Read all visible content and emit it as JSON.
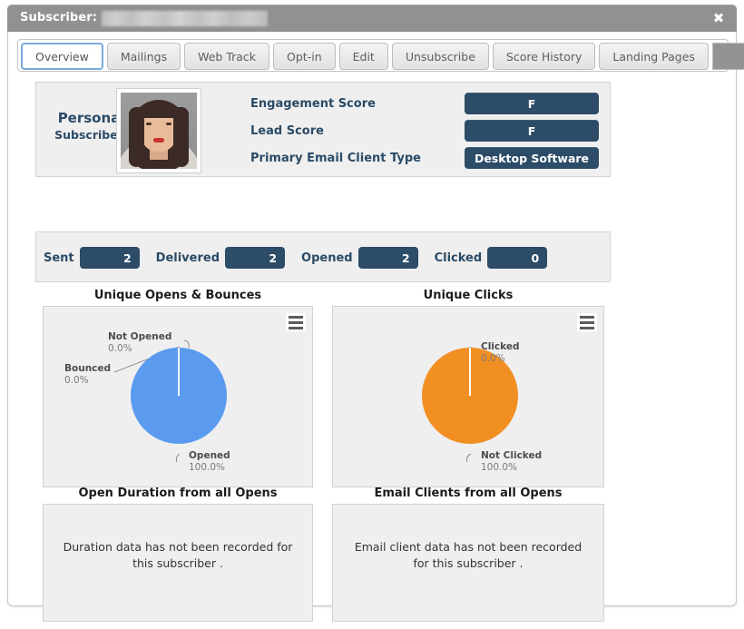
{
  "window": {
    "title_label": "Subscriber:",
    "subscriber_email_redacted": "",
    "close_label": "✖"
  },
  "tabs": [
    {
      "label": "Overview",
      "active": true
    },
    {
      "label": "Mailings",
      "active": false
    },
    {
      "label": "Web Track",
      "active": false
    },
    {
      "label": "Opt-in",
      "active": false
    },
    {
      "label": "Edit",
      "active": false
    },
    {
      "label": "Unsubscribe",
      "active": false
    },
    {
      "label": "Score History",
      "active": false
    },
    {
      "label": "Landing Pages",
      "active": false
    }
  ],
  "persona": {
    "title": "Persona",
    "subtitle": "Subscriber",
    "photo_alt": "subscriber-portrait",
    "scores": [
      {
        "label": "Engagement Score",
        "value": "F"
      },
      {
        "label": "Lead Score",
        "value": "F"
      },
      {
        "label": "Primary Email Client Type",
        "value": "Desktop Software"
      }
    ]
  },
  "stats": [
    {
      "label": "Sent",
      "value": "2"
    },
    {
      "label": "Delivered",
      "value": "2"
    },
    {
      "label": "Opened",
      "value": "2"
    },
    {
      "label": "Clicked",
      "value": "0"
    }
  ],
  "charts": {
    "opens_title": "Unique Opens & Bounces",
    "clicks_title": "Unique Clicks",
    "menu_icon": "hamburger-menu-icon"
  },
  "nodata": {
    "duration_title": "Open Duration from all Opens",
    "duration_message": "Duration data has not been recorded for this subscriber .",
    "clients_title": "Email Clients from all Opens",
    "clients_message": "Email client data has not been recorded for this subscriber ."
  },
  "colors": {
    "accent_navy": "#2c4c68",
    "pie_blue": "#5a9bf0",
    "pie_orange": "#f28f23",
    "titlebar_gray": "#919191",
    "panel_gray": "#efefef"
  },
  "chart_data": [
    {
      "type": "pie",
      "title": "Unique Opens & Bounces",
      "categories": [
        "Opened",
        "Not Opened",
        "Bounced"
      ],
      "values": [
        100.0,
        0.0,
        0.0
      ],
      "value_labels": [
        "100.0%",
        "0.0%",
        "0.0%"
      ],
      "colors": [
        "#5a9bf0",
        "#5a9bf0",
        "#5a9bf0"
      ],
      "legend": "data-labels-with-leader-lines",
      "grid": false
    },
    {
      "type": "pie",
      "title": "Unique Clicks",
      "categories": [
        "Not Clicked",
        "Clicked"
      ],
      "values": [
        100.0,
        0.0
      ],
      "value_labels": [
        "100.0%",
        "0.0%"
      ],
      "colors": [
        "#f28f23",
        "#f28f23"
      ],
      "legend": "data-labels-with-leader-lines",
      "grid": false
    }
  ]
}
